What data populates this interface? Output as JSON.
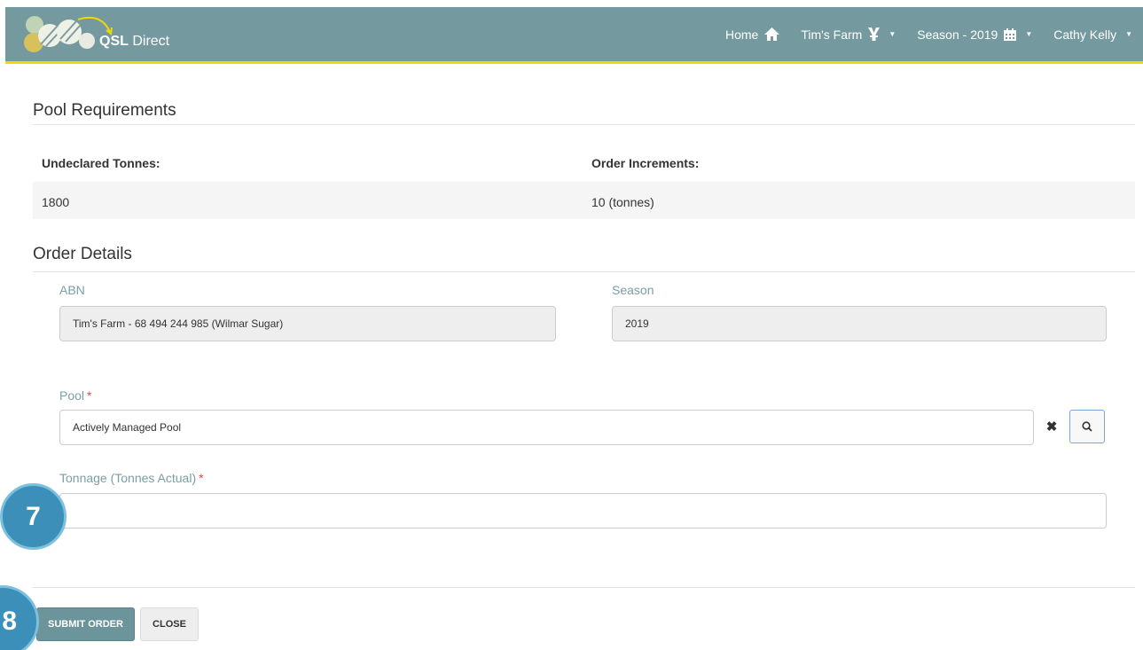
{
  "navbar": {
    "brand_bold": "QSL",
    "brand_rest": " Direct",
    "home": "Home",
    "farm": "Tim's Farm",
    "season": "Season - 2019",
    "user": "Cathy Kelly"
  },
  "pool_requirements": {
    "title": "Pool Requirements",
    "undeclared_label": "Undeclared Tonnes:",
    "undeclared_value": "1800",
    "increments_label": "Order Increments:",
    "increments_value": "10 (tonnes)"
  },
  "order_details": {
    "title": "Order Details",
    "abn_label": "ABN",
    "abn_value": "Tim's Farm - 68 494 244 985 (Wilmar Sugar)",
    "season_label": "Season",
    "season_value": "2019",
    "pool_label": "Pool",
    "pool_value": "Actively Managed Pool",
    "tonnage_label": "Tonnage (Tonnes Actual)",
    "tonnage_value": "",
    "required_mark": "*"
  },
  "callouts": {
    "step7": "7",
    "step8": "8"
  },
  "actions": {
    "submit": "SUBMIT ORDER",
    "close": "CLOSE"
  },
  "colors": {
    "navbar": "#749aa0",
    "accent_bar": "#f0d800",
    "label": "#7a9ea5",
    "primary_button": "#6c959b",
    "callout": "#3b8fb8"
  }
}
